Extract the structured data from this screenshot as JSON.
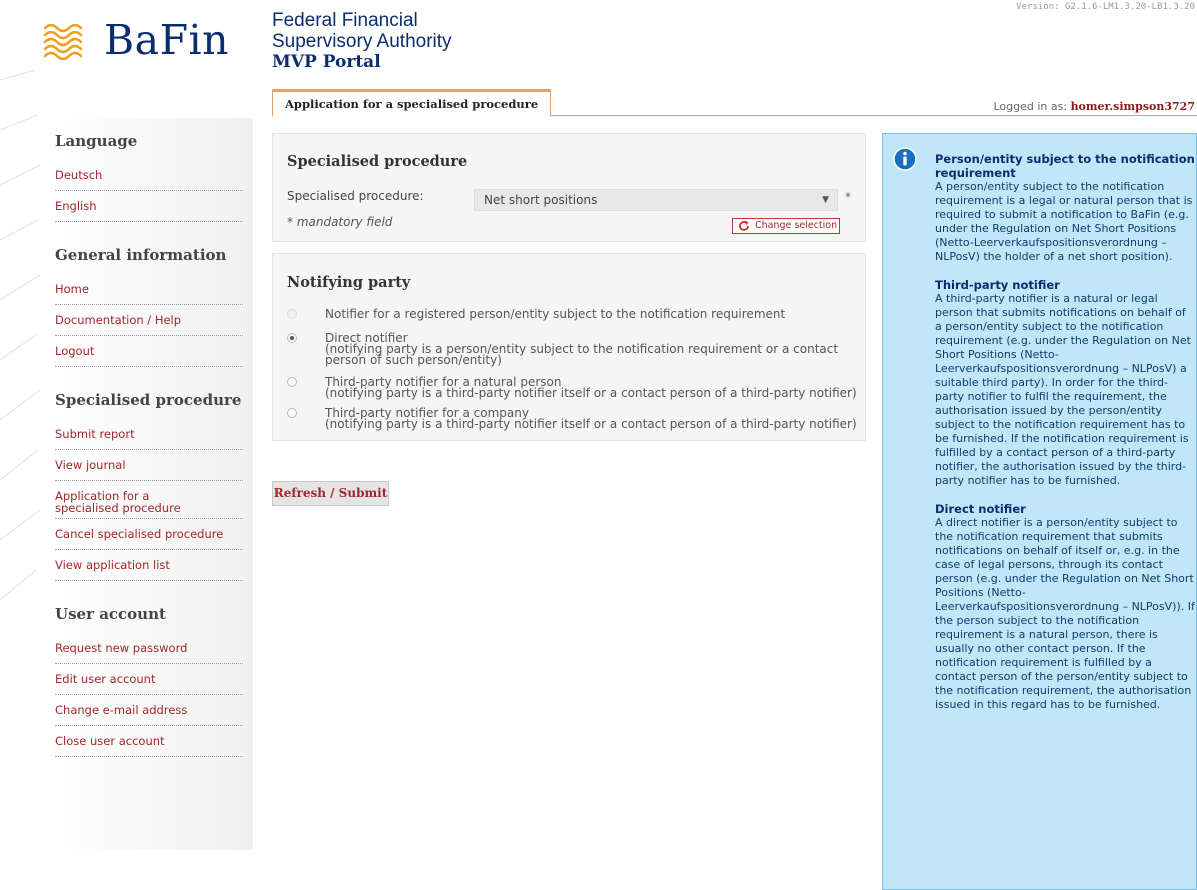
{
  "header": {
    "logo_text": "BaFin",
    "authority_line1": "Federal Financial",
    "authority_line2": "Supervisory Authority",
    "portal": "MVP Portal",
    "version": "Version: G2.1.6-LM1.3.20-LB1.3.20",
    "tab_label": "Application for a specialised procedure",
    "logged_in_label": "Logged in as:",
    "username": "homer.simpson3727"
  },
  "sidebar": {
    "groups": [
      {
        "title": "Language",
        "items": [
          "Deutsch",
          "English"
        ]
      },
      {
        "title": "General information",
        "items": [
          "Home",
          "Documentation / Help",
          "Logout"
        ]
      },
      {
        "title": "Specialised procedure",
        "items": [
          "Submit report",
          "View journal",
          "Application for a specialised procedure",
          "Cancel specialised procedure",
          "View application list"
        ]
      },
      {
        "title": "User account",
        "items": [
          "Request new password",
          "Edit user account",
          "Change e-mail address",
          "Close user account"
        ]
      }
    ]
  },
  "specialised": {
    "title": "Specialised procedure",
    "field_label": "Specialised procedure:",
    "selected": "Net short positions",
    "asterisk": "*",
    "mandatory": "* mandatory field",
    "change_button": "Change selection"
  },
  "notifying": {
    "title": "Notifying party",
    "options": [
      {
        "line1": "Notifier for a registered person/entity subject to the notification requirement",
        "line2": "",
        "line3": "",
        "state": "disabled"
      },
      {
        "line1": "Direct notifier",
        "line2": "(notifying party is a person/entity subject to the notification requirement or a contact",
        "line3": "person of such person/entity)",
        "state": "checked"
      },
      {
        "line1": "Third-party notifier for a natural person",
        "line2": "(notifying party is a third-party notifier itself or a contact person of a third-party notifier)",
        "line3": "",
        "state": "unchecked"
      },
      {
        "line1": "Third-party notifier for a company",
        "line2": "(notifying party is a third-party notifier itself or a contact person of a third-party notifier)",
        "line3": "",
        "state": "unchecked"
      }
    ]
  },
  "submit_button": "Refresh / Submit",
  "info": {
    "sections": [
      {
        "title": "Person/entity subject to the notification requirement",
        "text": "A person/entity subject to the notification requirement is a legal or natural person that is required to submit a notification to BaFin (e.g. under the Regulation on Net Short Positions (Netto-Leerverkaufspositionsverordnung – NLPosV) the holder of a net short position)."
      },
      {
        "title": "Third-party notifier",
        "text": "A third-party notifier is a natural or legal person that submits notifications on behalf of a person/entity subject to the notification requirement (e.g. under the Regulation on Net Short Positions (Netto-Leerverkaufspositionsverordnung – NLPosV) a suitable third party). In order for the third-party notifier to fulfil the requirement, the authorisation issued by the person/entity subject to the notification requirement has to be furnished. If the notification requirement is fulfilled by a contact person of a third-party notifier, the authorisation issued by the third-party notifier has to be furnished."
      },
      {
        "title": "Direct notifier",
        "text": "A direct notifier is a person/entity subject to the notification requirement that submits notifications on behalf of itself or, e.g. in the case of legal persons, through its contact person (e.g. under the Regulation on Net Short Positions (Netto-Leerverkaufspositionsverordnung – NLPosV)). If the person subject to the notification requirement is a natural person, there is usually no other contact person. If the notification requirement is fulfilled by a contact person of the person/entity subject to the notification requirement, the authorisation issued in this regard has to be furnished."
      }
    ]
  },
  "colors": {
    "brand_navy": "#0a2d6e",
    "link_red": "#a0282a",
    "tab_orange": "#e8a067",
    "info_bg": "#c0e6f8"
  }
}
